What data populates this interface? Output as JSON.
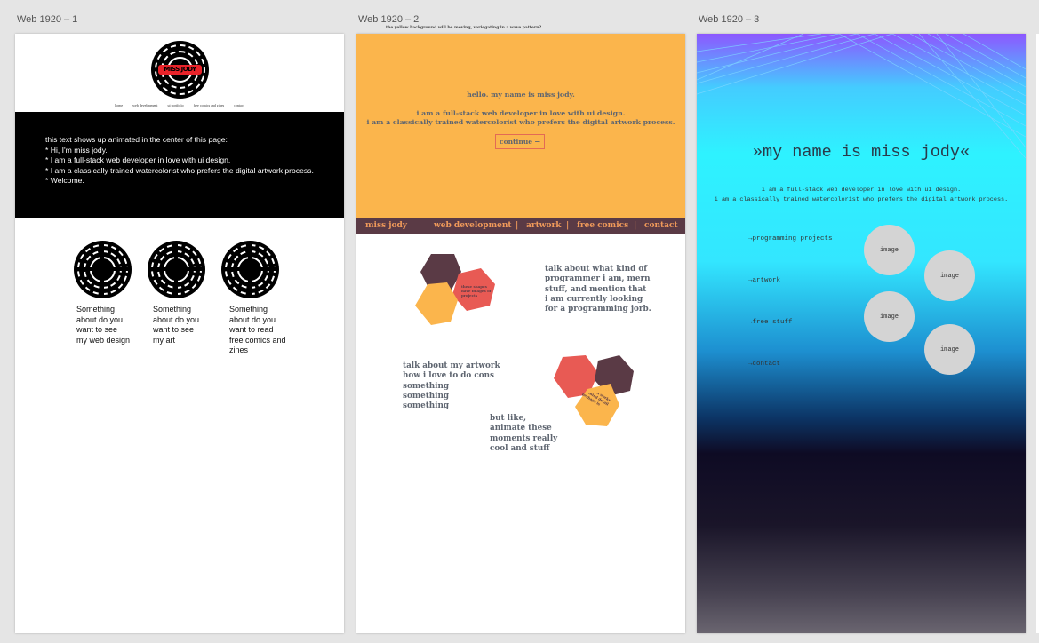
{
  "artboards": [
    {
      "label": "Web 1920 – 1"
    },
    {
      "label": "Web 1920 – 2"
    },
    {
      "label": "Web 1920 – 3"
    }
  ],
  "page1": {
    "logo_text": "MISS JODY",
    "nav": [
      "home",
      "web development",
      "ui portfolio",
      "free comics and zines",
      "contact"
    ],
    "black_lines": [
      "this text shows up animated in the center of this page:",
      "* Hi, I'm miss jody.",
      "* I am a full-stack web developer in love with ui design.",
      "* I am a classically trained watercolorist who prefers the digital artwork process.",
      "* Welcome."
    ],
    "captions": [
      "Something\nabout do you\nwant to see\nmy web design",
      "Something\nabout do you\nwant to see\nmy art",
      "Something\nabout do you\nwant to read\nfree comics and\nzines"
    ]
  },
  "page2": {
    "top_note": "the yellow background will be moving, variegating in a wave pattern?",
    "hello": "hello. my name is miss jody.",
    "line1": "i am a full-stack web developer in love with ui design.",
    "line2": "i am a classically trained watercolorist who prefers the digital artwork process.",
    "continue": "continue →",
    "nav": {
      "brand": "miss jody",
      "web": "web development",
      "sep1": "|",
      "artwork": "artwork",
      "sep2": "|",
      "comics": "free comics",
      "sep3": "|",
      "contact": "contact"
    },
    "hex_note1": "these shapes have images of projects",
    "hex_note2": "vegetal works painted detail perhaps is",
    "para1": "talk about what kind of\nprogrammer i am, mern\nstuff, and mention that\ni am currently looking\nfor a programming jorb.",
    "para2": "talk about my artwork\nhow i love to do cons\nsomething\nsomething\nsomething",
    "para3": "but like,\nanimate these\nmoments really\ncool and stuff"
  },
  "page3": {
    "title": "»my name is miss jody«",
    "sub1": "i am a full-stack web developer in love with ui design.",
    "sub2": "i am a classically trained watercolorist who prefers the digital artwork process.",
    "menu": [
      "→programming projects",
      "→artwork",
      "→free stuff",
      "→contact"
    ],
    "images": [
      "image",
      "image",
      "image",
      "image"
    ]
  },
  "colors": {
    "yellow": "#fbb54c",
    "maroon": "#5a3a45",
    "coral": "#e85a54",
    "orange_text": "#f09a5a",
    "slate_text": "#5e6570"
  }
}
